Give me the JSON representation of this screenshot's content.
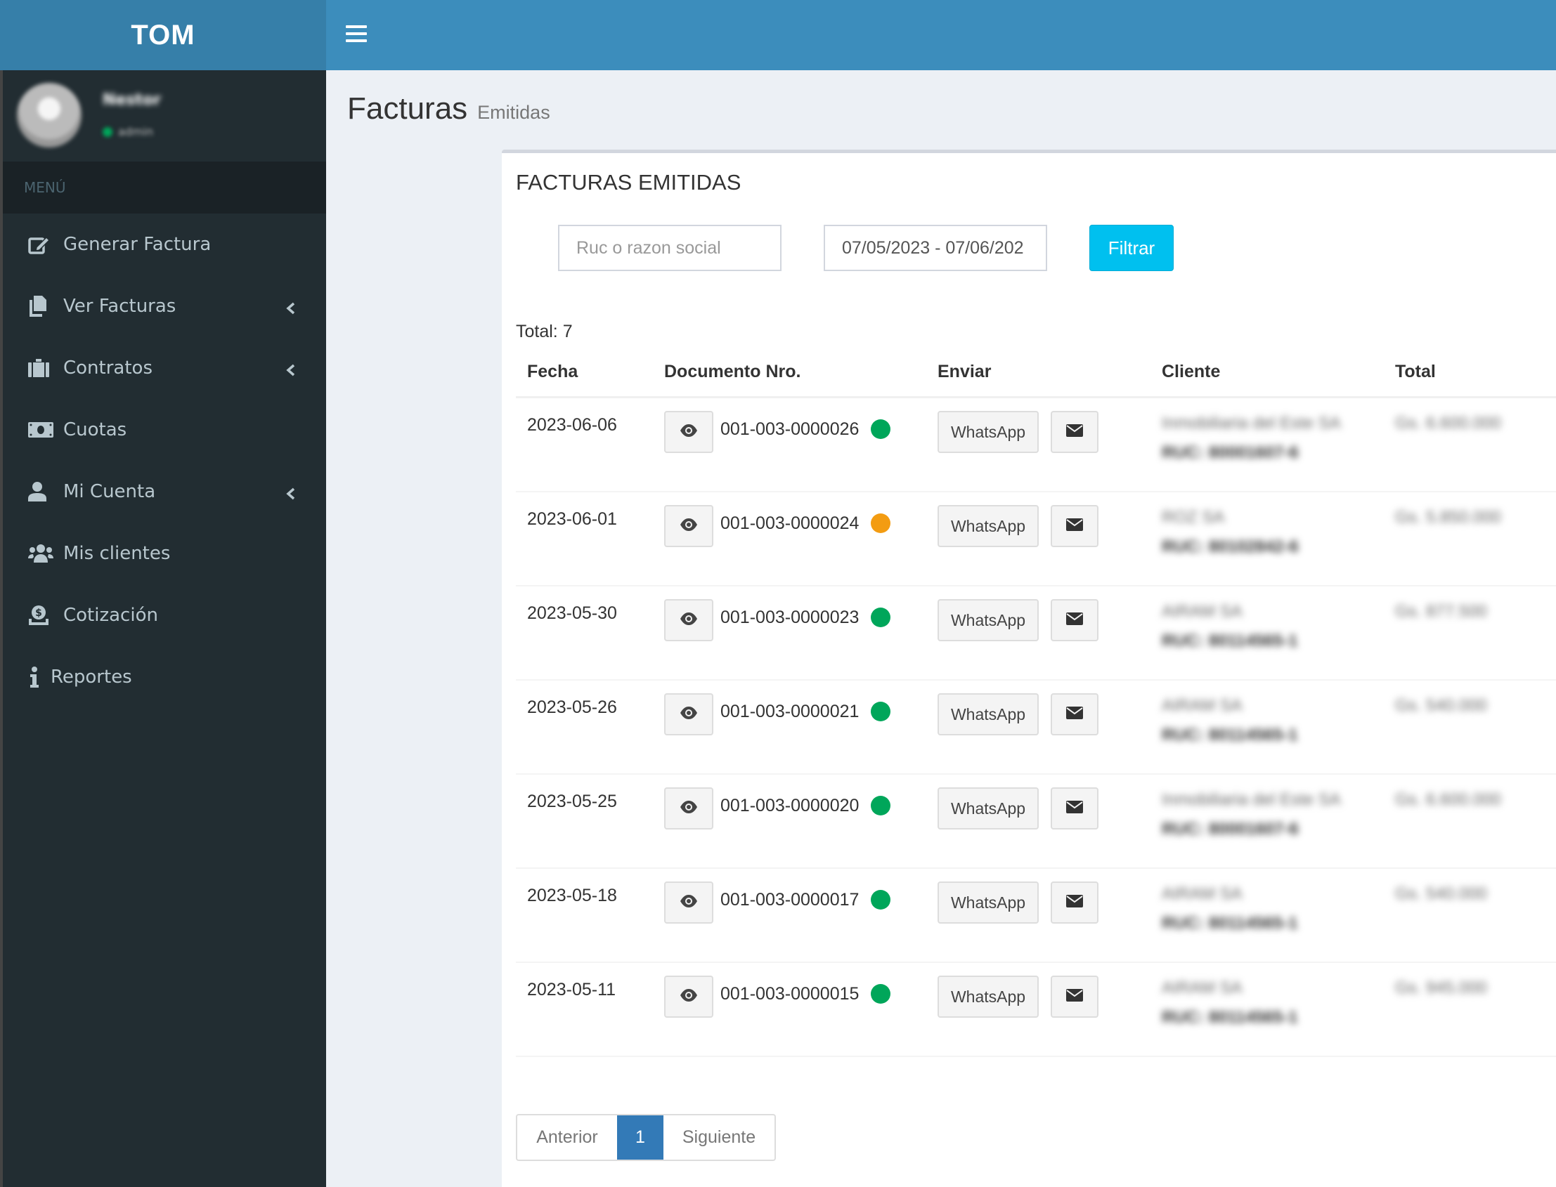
{
  "app": {
    "logo": "TOM",
    "menu_toggle_icon": "hamburger-icon"
  },
  "user": {
    "name": "Nestor",
    "status": "admin"
  },
  "sidebar": {
    "header": "MENÚ",
    "items": [
      {
        "label": "Generar Factura",
        "icon": "edit-icon",
        "has_submenu": false
      },
      {
        "label": "Ver Facturas",
        "icon": "files-icon",
        "has_submenu": true
      },
      {
        "label": "Contratos",
        "icon": "briefcase-icon",
        "has_submenu": true
      },
      {
        "label": "Cuotas",
        "icon": "money-bill-icon",
        "has_submenu": false
      },
      {
        "label": "Mi Cuenta",
        "icon": "user-icon",
        "has_submenu": true
      },
      {
        "label": "Mis clientes",
        "icon": "users-icon",
        "has_submenu": false
      },
      {
        "label": "Cotización",
        "icon": "donate-icon",
        "has_submenu": false
      },
      {
        "label": "Reportes",
        "icon": "info-icon",
        "has_submenu": false
      }
    ]
  },
  "page": {
    "title": "Facturas",
    "subtitle": "Emitidas"
  },
  "box": {
    "title": "FACTURAS EMITIDAS",
    "search_placeholder": "Ruc o razon social",
    "search_value": "",
    "date_range_value": "07/05/2023 - 07/06/202",
    "filter_label": "Filtrar",
    "total_label": "Total: 7"
  },
  "table": {
    "columns": [
      "Fecha",
      "Documento Nro.",
      "Enviar",
      "Cliente",
      "Total"
    ],
    "whatsapp_label": "WhatsApp",
    "status_colors": {
      "ok": "#00a65a",
      "pending": "#f39c12"
    },
    "rows": [
      {
        "fecha": "2023-06-06",
        "documento": "001-003-0000026",
        "status": "ok",
        "cliente": "Inmobiliaria del Este SA",
        "ruc": "RUC: 80001607-6",
        "total": "Gs. 6.600.000"
      },
      {
        "fecha": "2023-06-01",
        "documento": "001-003-0000024",
        "status": "pending",
        "cliente": "ROZ SA",
        "ruc": "RUC: 80102842-6",
        "total": "Gs. 5.850.000"
      },
      {
        "fecha": "2023-05-30",
        "documento": "001-003-0000023",
        "status": "ok",
        "cliente": "AIRAM SA",
        "ruc": "RUC: 80114565-1",
        "total": "Gs. 877.500"
      },
      {
        "fecha": "2023-05-26",
        "documento": "001-003-0000021",
        "status": "ok",
        "cliente": "AIRAM SA",
        "ruc": "RUC: 80114565-1",
        "total": "Gs. 540.000"
      },
      {
        "fecha": "2023-05-25",
        "documento": "001-003-0000020",
        "status": "ok",
        "cliente": "Inmobiliaria del Este SA",
        "ruc": "RUC: 80001607-6",
        "total": "Gs. 6.600.000"
      },
      {
        "fecha": "2023-05-18",
        "documento": "001-003-0000017",
        "status": "ok",
        "cliente": "AIRAM SA",
        "ruc": "RUC: 80114565-1",
        "total": "Gs. 540.000"
      },
      {
        "fecha": "2023-05-11",
        "documento": "001-003-0000015",
        "status": "ok",
        "cliente": "AIRAM SA",
        "ruc": "RUC: 80114565-1",
        "total": "Gs. 945.000"
      }
    ]
  },
  "pagination": {
    "prev_label": "Anterior",
    "current_page": "1",
    "next_label": "Siguiente"
  }
}
